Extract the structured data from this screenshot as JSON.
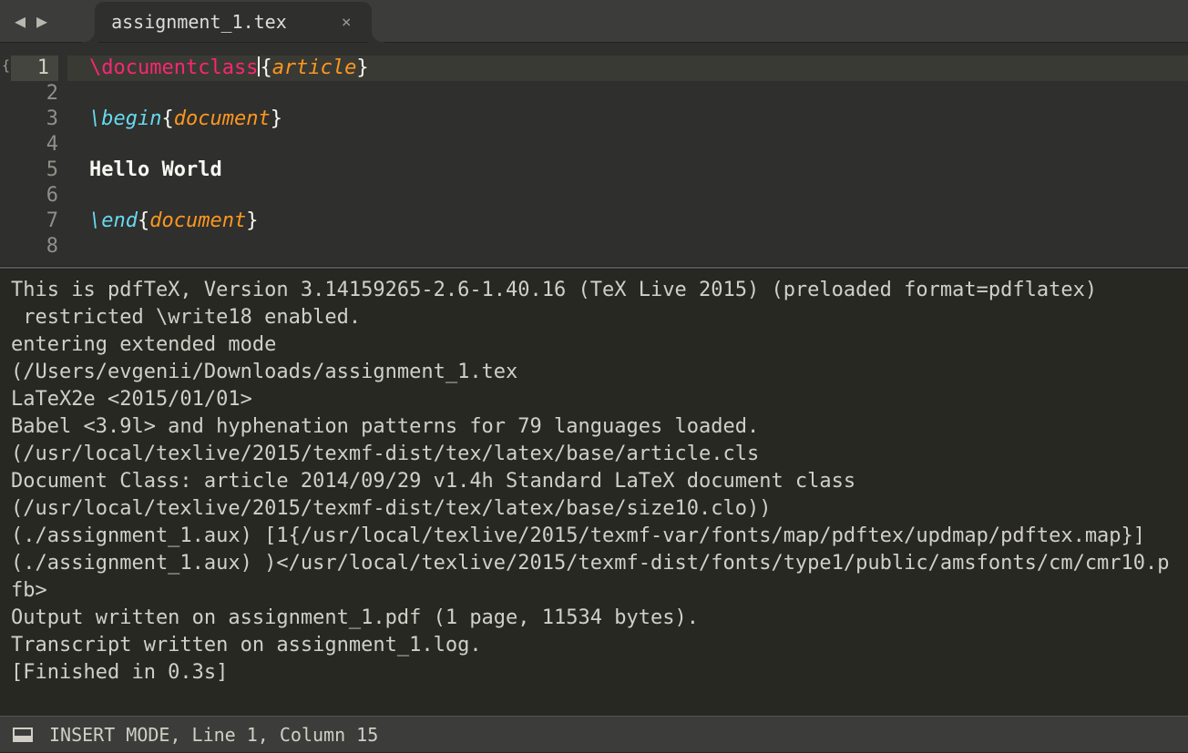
{
  "tab": {
    "filename": "assignment_1.tex"
  },
  "fold_icon": "{}",
  "lines": [
    "1",
    "2",
    "3",
    "4",
    "5",
    "6",
    "7",
    "8"
  ],
  "code": {
    "l1": {
      "cmd": "\\documentclass",
      "lb": "{",
      "p": "article",
      "rb": "}"
    },
    "l3": {
      "cmd": "\\begin",
      "lb": "{",
      "p": "document",
      "rb": "}"
    },
    "l5": "Hello World",
    "l7": {
      "cmd": "\\end",
      "lb": "{",
      "p": "document",
      "rb": "}"
    }
  },
  "console": "This is pdfTeX, Version 3.14159265-2.6-1.40.16 (TeX Live 2015) (preloaded format=pdflatex)\n restricted \\write18 enabled.\nentering extended mode\n(/Users/evgenii/Downloads/assignment_1.tex\nLaTeX2e <2015/01/01>\nBabel <3.9l> and hyphenation patterns for 79 languages loaded.\n(/usr/local/texlive/2015/texmf-dist/tex/latex/base/article.cls\nDocument Class: article 2014/09/29 v1.4h Standard LaTeX document class\n(/usr/local/texlive/2015/texmf-dist/tex/latex/base/size10.clo))\n(./assignment_1.aux) [1{/usr/local/texlive/2015/texmf-var/fonts/map/pdftex/updmap/pdftex.map}] (./assignment_1.aux) )</usr/local/texlive/2015/texmf-dist/fonts/type1/public/amsfonts/cm/cmr10.pfb>\nOutput written on assignment_1.pdf (1 page, 11534 bytes).\nTranscript written on assignment_1.log.\n[Finished in 0.3s]",
  "status": "INSERT MODE, Line 1, Column 15"
}
